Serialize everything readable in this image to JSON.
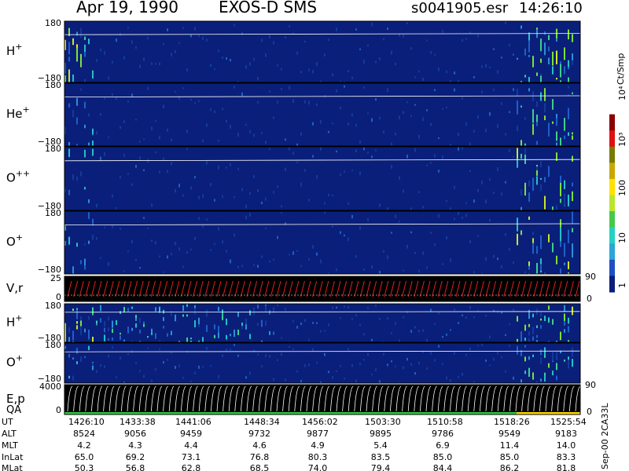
{
  "header": {
    "date": "Apr 19, 1990",
    "instrument": "EXOS-D SMS",
    "file": "s0041905.esr",
    "time": "14:26:10"
  },
  "colorbar": {
    "unit": "Ct/Smp",
    "labels": [
      "1",
      "10",
      "100",
      "10³",
      "10⁴"
    ],
    "stops": [
      "#0a1f7a",
      "#1f4fc4",
      "#2aa7d6",
      "#25d1c3",
      "#46c94a",
      "#b8e62d",
      "#ffe100",
      "#c8a800",
      "#7a7a00",
      "#e01010",
      "#8b0000",
      "#ffffff"
    ]
  },
  "panels": [
    {
      "id": "h-plus",
      "label_base": "H",
      "label_sup": "+",
      "ytop": "180",
      "ybot": "−180"
    },
    {
      "id": "he-plus",
      "label_base": "He",
      "label_sup": "+",
      "ytop": "180",
      "ybot": "−180"
    },
    {
      "id": "o-plusplus",
      "label_base": "O",
      "label_sup": "++",
      "ytop": "180",
      "ybot": "−180"
    },
    {
      "id": "o-plus",
      "label_base": "O",
      "label_sup": "+",
      "ytop": "180",
      "ybot": "−180"
    },
    {
      "id": "vr",
      "label_base": "V,r",
      "label_sup": "",
      "ytop": "25",
      "ybot": "0",
      "right_top": "90",
      "right_bot": "0"
    },
    {
      "id": "h-plus-2",
      "label_base": "H",
      "label_sup": "+",
      "ytop": "180",
      "ybot": "−180"
    },
    {
      "id": "o-plus-2",
      "label_base": "O",
      "label_sup": "+",
      "ytop": "180",
      "ybot": "−180"
    },
    {
      "id": "ep",
      "label_base": "E,p",
      "label_sup": "",
      "label2": "QA",
      "ytop": "4000",
      "ybot": "0",
      "right_top": "90",
      "right_bot": "0"
    }
  ],
  "footer": {
    "row_labels": [
      "UT",
      "ALT",
      "MLT",
      "InLat",
      "MLat"
    ],
    "side_text": "Sep-00  2CA33L"
  },
  "chart_data": {
    "type": "heatmap",
    "title": "Apr 19, 1990   EXOS-D SMS",
    "x_ticks": [
      "1426:10",
      "1433:38",
      "1441:06",
      "1448:34",
      "1456:02",
      "1503:30",
      "1510:58",
      "1518:26",
      "1525:54"
    ],
    "ephemeris": {
      "ALT": [
        "8524",
        "9056",
        "9459",
        "9732",
        "9877",
        "9895",
        "9786",
        "9549",
        "9183"
      ],
      "MLT": [
        "4.2",
        "4.3",
        "4.4",
        "4.6",
        "4.9",
        "5.4",
        "6.9",
        "11.4",
        "14.0"
      ],
      "InLat": [
        "65.0",
        "69.2",
        "73.1",
        "76.8",
        "80.3",
        "83.5",
        "85.0",
        "85.0",
        "83.3"
      ],
      "MLat": [
        "50.3",
        "56.8",
        "62.8",
        "68.5",
        "74.0",
        "79.4",
        "84.4",
        "86.2",
        "81.8"
      ]
    },
    "color_scale": "log",
    "color_range": [
      1,
      10000
    ],
    "colorbar_label": "Ct/Smp"
  }
}
